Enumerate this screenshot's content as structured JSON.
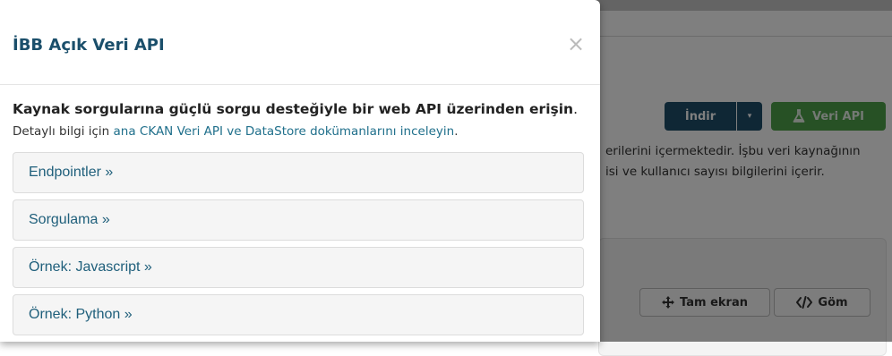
{
  "background": {
    "download_button": "İndir",
    "download_caret": "▾",
    "data_api_button": "Veri API",
    "description_lines": [
      "erilerini içermektedir. İşbu veri kaynağının",
      "isi ve kullanıcı sayısı bilgilerini içerir."
    ],
    "fullscreen_button": "Tam ekran",
    "embed_button": "Göm",
    "colors": {
      "primary": "#1f4e6b",
      "success": "#4ea24a"
    }
  },
  "modal": {
    "title": "İBB Açık Veri API",
    "close_symbol": "×",
    "lead_bold": "Kaynak sorgularına güçlü sorgu desteğiyle bir web API üzerinden erişin",
    "lead_end": ".",
    "sub_prefix": "Detaylı bilgi için ",
    "sub_link": "ana CKAN Veri API ve DataStore dokümanlarını inceleyin",
    "sub_suffix": ".",
    "accordion": [
      {
        "label": "Endpointler »"
      },
      {
        "label": "Sorgulama »"
      },
      {
        "label": "Örnek: Javascript »"
      },
      {
        "label": "Örnek: Python »"
      }
    ]
  }
}
